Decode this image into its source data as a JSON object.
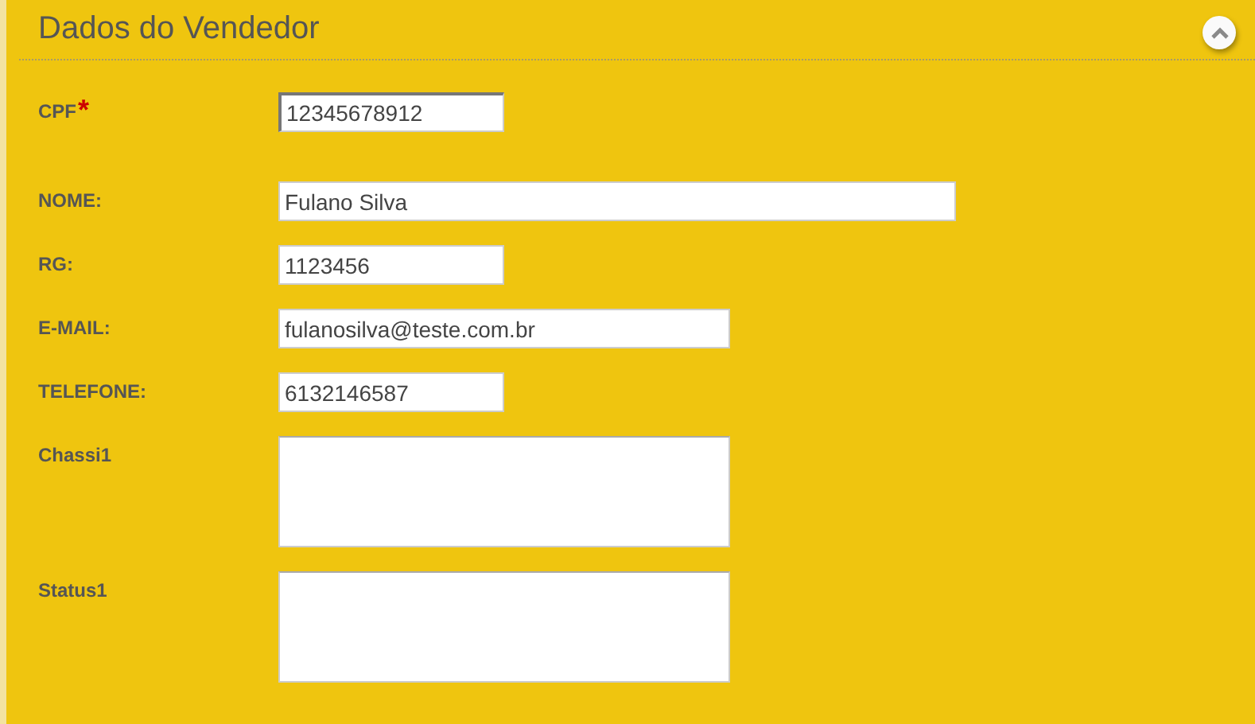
{
  "panel": {
    "title": "Dados do Vendedor",
    "collapse_button": {
      "expanded": true
    }
  },
  "fields": [
    {
      "label": "CPF",
      "required_mark": "*",
      "kind": "short",
      "value": "12345678912"
    },
    {
      "label": "NOME:",
      "kind": "long",
      "value": "Fulano Silva"
    },
    {
      "label": "RG:",
      "kind": "short",
      "value": "1123456"
    },
    {
      "label": "E-MAIL:",
      "kind": "medium",
      "value": "fulanosilva@teste.com.br"
    },
    {
      "label": "TELEFONE:",
      "kind": "short",
      "value": "6132146587"
    },
    {
      "label": "Chassi1",
      "kind": "area"
    },
    {
      "label": "Status1",
      "kind": "area"
    }
  ]
}
